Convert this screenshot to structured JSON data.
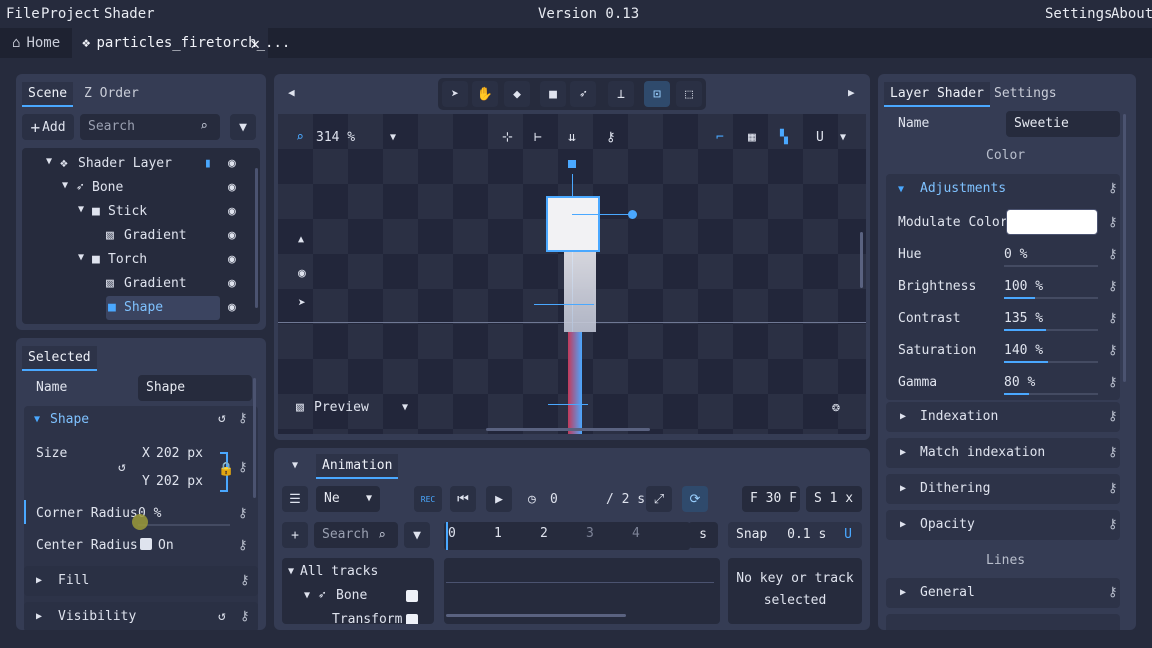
{
  "menu": {
    "file": "File",
    "project": "Project",
    "shader": "Shader",
    "version": "Version 0.13",
    "settings": "Settings",
    "about": "About"
  },
  "tabs": {
    "home": "Home",
    "file": "particles_firetorch_..."
  },
  "scene": {
    "tab_scene": "Scene",
    "tab_zorder": "Z Order",
    "add": "Add",
    "search_placeholder": "Search",
    "tree": [
      {
        "label": "Shader Layer"
      },
      {
        "label": "Bone"
      },
      {
        "label": "Stick"
      },
      {
        "label": "Gradient"
      },
      {
        "label": "Torch"
      },
      {
        "label": "Gradient"
      },
      {
        "label": "Shape"
      }
    ]
  },
  "selected": {
    "tab": "Selected",
    "name_label": "Name",
    "name_value": "Shape",
    "shape_section": "Shape",
    "size_label": "Size",
    "x_label": "X",
    "x_value": "202 px",
    "y_label": "Y",
    "y_value": "202 px",
    "corner_label": "Corner Radius",
    "corner_value": "0 %",
    "center_label": "Center Radius",
    "center_value": "On",
    "fill": "Fill",
    "visibility": "Visibility"
  },
  "viewport": {
    "zoom": "314 %",
    "preview": "Preview"
  },
  "animation": {
    "tab": "Animation",
    "mode": "Ne",
    "frame": "0",
    "duration": "/ 2 s",
    "fps": "F 30 F",
    "speed": "S 1 x",
    "search_placeholder": "Search",
    "ticks": [
      "0",
      "1",
      "2",
      "3",
      "4"
    ],
    "unit": "s",
    "snap_label": "Snap",
    "snap_value": "0.1 s",
    "all_tracks": "All tracks",
    "track_bone": "Bone",
    "track_transform": "Transform",
    "no_key": "No key or track selected",
    "rec": "REC"
  },
  "shader": {
    "tab_layer": "Layer Shader",
    "tab_settings": "Settings",
    "name_label": "Name",
    "name_value": "Sweetie",
    "color_heading": "Color",
    "adjustments": "Adjustments",
    "modulate": "Modulate Color",
    "params": [
      {
        "label": "Hue",
        "value": "0 %",
        "fraction": 0
      },
      {
        "label": "Brightness",
        "value": "100 %",
        "fraction": 0.33
      },
      {
        "label": "Contrast",
        "value": "135 %",
        "fraction": 0.45
      },
      {
        "label": "Saturation",
        "value": "140 %",
        "fraction": 0.47
      },
      {
        "label": "Gamma",
        "value": "80 %",
        "fraction": 0.27
      }
    ],
    "sections": [
      "Indexation",
      "Match indexation",
      "Dithering",
      "Opacity"
    ],
    "lines_heading": "Lines",
    "general": "General"
  },
  "colors": {
    "accent": "#4aa8ff",
    "panel": "#353c54",
    "bg": "#262b3d"
  }
}
